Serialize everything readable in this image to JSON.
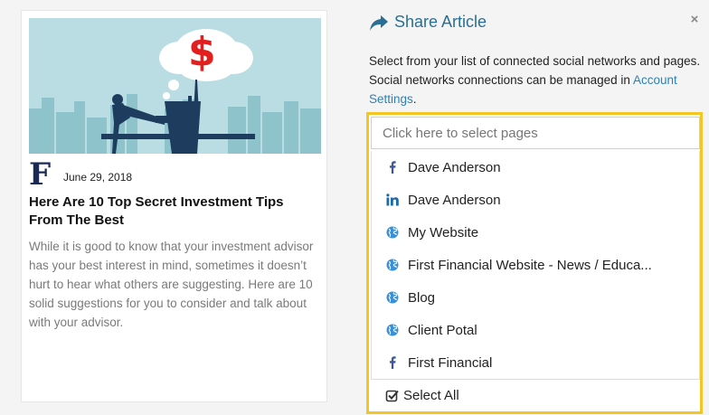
{
  "article": {
    "logo_letter": "F",
    "date": "June 29, 2018",
    "title": "Here Are 10 Top Secret Investment Tips From The Best",
    "excerpt": "While it is good to know that your investment advisor has your best interest in mind, sometimes it doesn’t hurt to hear what others are suggesting. Here are 10 solid suggestions for you to consider and talk about with your advisor.",
    "image_symbol": "$"
  },
  "share": {
    "title": "Share Article",
    "close": "×",
    "description": "Select from your list of connected social networks and pages. Social networks connections can be managed in ",
    "settings_link": "Account Settings",
    "settings_suffix": ".",
    "placeholder": "Click here to select pages",
    "select_all": "Select All"
  },
  "pages": [
    {
      "label": "Dave Anderson",
      "icon": "facebook-icon"
    },
    {
      "label": "Dave Anderson",
      "icon": "linkedin-icon"
    },
    {
      "label": "My Website",
      "icon": "globe-icon"
    },
    {
      "label": "First Financial Website - News / Educa...",
      "icon": "globe-icon"
    },
    {
      "label": "Blog",
      "icon": "globe-icon"
    },
    {
      "label": "Client Potal",
      "icon": "globe-icon"
    },
    {
      "label": "First Financial",
      "icon": "facebook-icon"
    }
  ],
  "colors": {
    "accent": "#2a6f93",
    "link": "#2a82b8",
    "highlight": "#f3c623",
    "facebook": "#3b5998",
    "linkedin": "#1c6aa8",
    "globe": "#3a8fd6",
    "dollar": "#e21f1f"
  }
}
